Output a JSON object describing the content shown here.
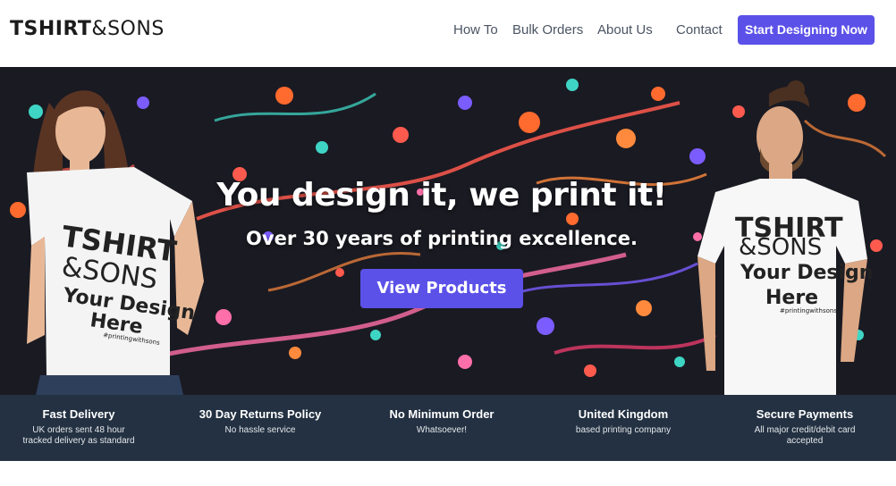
{
  "header": {
    "logo_bold": "TSHIRT",
    "logo_light": "&SONS",
    "nav": [
      "How To",
      "Bulk Orders",
      "About Us",
      "Contact"
    ],
    "cta": "Start Designing Now"
  },
  "hero": {
    "headline": "You design it, we print it!",
    "subline": "Over 30 years of printing excellence.",
    "button": "View Products",
    "shirt_left": [
      "TSHIRT",
      "&SONS",
      "Your Design",
      "Here",
      "#printingwithsons"
    ],
    "shirt_right": [
      "TSHIRT",
      "&SONS",
      "Your Design",
      "Here",
      "#printingwithsons"
    ]
  },
  "features": [
    {
      "title": "Fast Delivery",
      "desc_lines": [
        "UK orders sent 48 hour",
        "tracked delivery as standard"
      ]
    },
    {
      "title": "30 Day Returns Policy",
      "desc_lines": [
        "No hassle service",
        ""
      ]
    },
    {
      "title": "No Minimum Order",
      "desc_lines": [
        "Whatsoever!",
        ""
      ]
    },
    {
      "title": "United Kingdom",
      "desc_lines": [
        "based printing company",
        ""
      ]
    },
    {
      "title": "Secure Payments",
      "desc_lines": [
        "All major credit/debit card",
        "accepted"
      ]
    }
  ],
  "colors": {
    "accent": "#5b51e8",
    "hero_bg": "#1a1a22",
    "features_bg": "#233142",
    "nav_text": "#4b5563"
  }
}
